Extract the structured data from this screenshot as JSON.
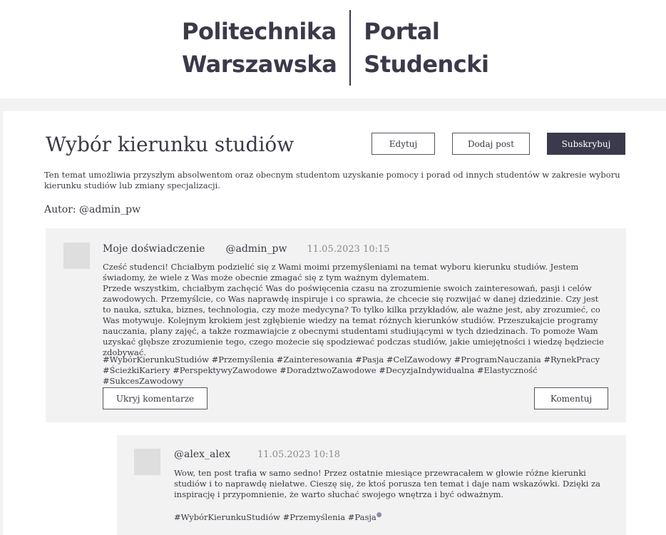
{
  "logo": {
    "left_line1": "Politechnika",
    "left_line2": "Warszawska",
    "right_line1": "Portal",
    "right_line2": "Studencki"
  },
  "topic": {
    "title": "Wybór kierunku studiów",
    "description": "Ten temat umożliwia przyszłym absolwentom oraz obecnym studentom uzyskanie pomocy i porad od innych studentów w zakresie wyboru kierunku studiów lub zmiany specjalizacji.",
    "author": "Autor: @admin_pw"
  },
  "actions": {
    "edit_label": "Edytuj",
    "add_post_label": "Dodaj post",
    "subscribe_label": "Subskrybuj"
  },
  "post": {
    "title": "Moje doświadczenie",
    "author": "@admin_pw",
    "date": "11.05.2023 10:15",
    "body_p1": "Cześć studenci! Chciałbym podzielić się z Wami moimi przemyśleniami na temat wyboru kierunku studiów. Jestem świadomy, że wiele z Was może obecnie zmagać się z tym ważnym dylematem.",
    "body_p2": "Przede wszystkim, chciałbym zachęcić Was do poświęcenia czasu na zrozumienie swoich zainteresowań, pasji i celów zawodowych. Przemyślcie, co Was naprawdę inspiruje i co sprawia, że chcecie się rozwijać w danej dziedzinie. Czy jest to nauka, sztuka, biznes, technologia, czy może medycyna? To tylko kilka przykładów, ale ważne jest, aby zrozumieć, co Was motywuje. Kolejnym krokiem jest zgłębienie wiedzy na temat różnych kierunków studiów. Przeszukajcie programy nauczania, plany zajęć, a także rozmawiajcie z obecnymi studentami studiującymi w tych dziedzinach. To pomoże Wam uzyskać głębsze zrozumienie tego, czego możecie się spodziewać podczas studiów, jakie umiejętności i wiedzę będziecie zdobywać.",
    "tags": "#WybórKierunkuStudiów #Przemyślenia #Zainteresowania #Pasja #CelZawodowy #ProgramNauczania #RynekPracy #ŚcieżkiKariery #PerspektywyZawodowe #DoradztwoZawodowe #DecyzjaIndywidualna #Elastyczność #SukcesZawodowy",
    "hide_comments_label": "Ukryj komentarze",
    "comment_label": "Komentuj"
  },
  "comment": {
    "author": "@alex_alex",
    "date": "11.05.2023 10:18",
    "body": "Wow, ten post trafia w samo sedno! Przez ostatnie miesiące przewracałem w głowie różne kierunki studiów i to naprawdę niełatwe. Cieszę się, że ktoś porusza ten temat i daje nam wskazówki. Dzięki za inspirację i przypomnienie, że warto słuchać swojego wnętrza i być odważnym.",
    "tags": "#WybórKierunkuStudiów #Przemyślenia #Pasja"
  },
  "colors": {
    "accent_dark": "#3b3a4c",
    "page_bg": "#f3f2f2",
    "card_bg": "#ffffff",
    "muted_text": "#8a8a92"
  }
}
